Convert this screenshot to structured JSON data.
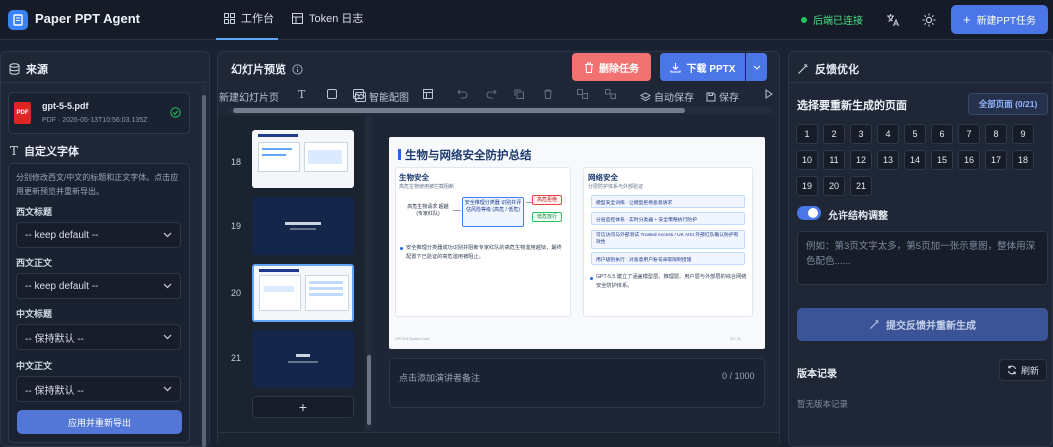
{
  "app": {
    "title": "Paper PPT Agent"
  },
  "nav": {
    "workbench": "工作台",
    "token_log": "Token 日志"
  },
  "status": {
    "text": "后端已连接"
  },
  "header": {
    "new_task": "新建PPT任务"
  },
  "source": {
    "title": "来源",
    "file_name": "gpt-5-5.pdf",
    "file_meta": "PDF · 2026-05-13T10:56:03.135Z",
    "file_badge": "PDF"
  },
  "fonts": {
    "title": "自定义字体",
    "desc": "分别修改西文/中文的标题和正文字体。点击应用更新预览并重新导出。",
    "western_title_label": "西文标题",
    "western_title_value": "-- keep default --",
    "western_body_label": "西文正文",
    "western_body_value": "-- keep default --",
    "cn_title_label": "中文标题",
    "cn_title_value": "-- 保持默认 --",
    "cn_body_label": "中文正文",
    "cn_body_value": "-- 保持默认 --",
    "apply_button": "应用并重新导出"
  },
  "preview": {
    "title": "幻灯片预览",
    "delete_task": "删除任务",
    "download": "下载 PPTX",
    "toolbar": {
      "new_slide": "新建幻灯片页",
      "smart_image": "智能配图",
      "autosave": "自动保存",
      "save": "保存"
    },
    "thumb_numbers": [
      "18",
      "19",
      "20",
      "21"
    ],
    "slide": {
      "title": "生物与网络安全防护总结",
      "bio_title": "生物安全",
      "bio_sub": "高危生物使用被拦截阻断",
      "bio_flow_left": "高危生物请求 超越(专家红队)",
      "bio_flow_mid": "安全推理分类器 识别并评估风险等级 (高危 / 低危)",
      "bio_flow_top": "高危拒绝",
      "bio_flow_bottom": "低危放行",
      "bio_bullet": "安全推理分类器成功识别并阻断专家红队的高危生物滥用越狱，最终配置下已验证的高危滥用被阻止。",
      "net_title": "网络安全",
      "net_sub": "分层防护体系与外部验证",
      "net_items": [
        "模型安全训练 · 让模型拒绝恶意请求",
        "分层监控体系 · 实时分类器 + 安全策略执行防护",
        "可信访问与外部测试 Trusted Access / UK AISI 外部红队确认防护有效性",
        "用户级别执行 · 对恶意用户账号采取限制措施"
      ],
      "net_bullet": "GPT-5.5 建立了涵盖模型层、推理层、用户层与外部层的综合网络安全防护体系。",
      "footer_left": "GPT-5.5 System Card",
      "footer_right": "20 / 21"
    },
    "notes_placeholder": "点击添加演讲者备注",
    "notes_count": "0 / 1000"
  },
  "feedback": {
    "title": "反馈优化",
    "select_pages": "选择要重新生成的页面",
    "all_pages": "全部页面 (0/21)",
    "pages": [
      "1",
      "2",
      "3",
      "4",
      "5",
      "6",
      "7",
      "8",
      "9",
      "10",
      "11",
      "12",
      "13",
      "14",
      "15",
      "16",
      "17",
      "18",
      "19",
      "20",
      "21"
    ],
    "allow_structure": "允许结构调整",
    "textarea_placeholder": "例如：第3页文字太多，第5页加一张示意图，整体用深色配色......",
    "submit": "提交反馈并重新生成",
    "history_title": "版本记录",
    "refresh": "刷新",
    "history_empty": "暂无版本记录"
  },
  "colors": {
    "accent": "#4a76e8",
    "danger": "#f87171",
    "success": "#22c55e"
  }
}
